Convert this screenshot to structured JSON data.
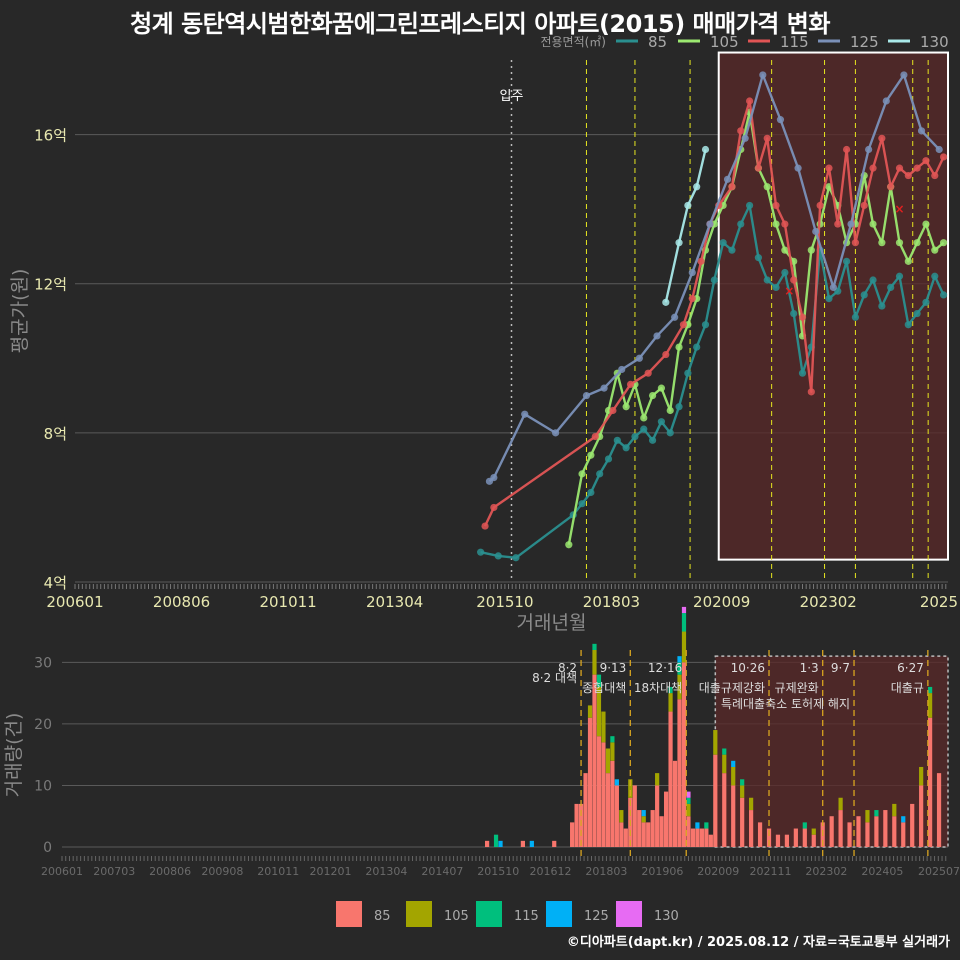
{
  "title": "청계 동탄역시범한화꿈에그린프레스티지 아파트(2015) 매매가격 변화",
  "footer": "©디아파트(dapt.kr) / 2025.08.12 / 자료=국토교통부 실거래가",
  "colors": {
    "background": "#282828",
    "grid": "#5a5a5a",
    "tick_text": "#e8e8b0",
    "axis_title": "#8a8a8a",
    "policy_line": "#e6e620",
    "policy_line_bottom": "#d9a520",
    "highlight_fill": "#5a2828",
    "highlight_stroke": "#ffffff"
  },
  "chart_data": [
    {
      "type": "line",
      "panel": "price",
      "legend_title": "전용면적(㎡)",
      "xlabel": "거래년월",
      "ylabel": "평균가(원)",
      "ylim": [
        4,
        18
      ],
      "xlim": [
        2006.0,
        2025.8
      ],
      "x_ticks": [
        "200601",
        "200806",
        "201011",
        "201304",
        "201510",
        "201803",
        "202009",
        "202302",
        "2025"
      ],
      "y_ticks": [
        "4억",
        "8억",
        "12억",
        "16억"
      ],
      "y_tick_values": [
        4,
        8,
        12,
        16
      ],
      "move_in_label": "입주",
      "move_in_x": 2015.9,
      "policy_x": [
        2017.6,
        2018.7,
        2019.95,
        2021.8,
        2023.0,
        2023.7,
        2025.0,
        2025.35
      ],
      "highlight_range": {
        "x": [
          2020.6,
          2025.8
        ],
        "y": [
          4.6,
          18.2
        ]
      },
      "outliers": [
        {
          "x": 2022.2,
          "y": 11.8
        },
        {
          "x": 2024.7,
          "y": 14.0
        }
      ],
      "series": [
        {
          "name": "85",
          "color": "#2a8f8f",
          "x": [
            2015.2,
            2015.6,
            2016.0,
            2017.3,
            2017.5,
            2017.7,
            2017.9,
            2018.1,
            2018.3,
            2018.5,
            2018.7,
            2018.9,
            2019.1,
            2019.3,
            2019.5,
            2019.7,
            2019.9,
            2020.1,
            2020.3,
            2020.5,
            2020.7,
            2020.9,
            2021.1,
            2021.3,
            2021.5,
            2021.7,
            2021.9,
            2022.1,
            2022.3,
            2022.5,
            2022.7,
            2022.9,
            2023.1,
            2023.3,
            2023.5,
            2023.7,
            2023.9,
            2024.1,
            2024.3,
            2024.5,
            2024.7,
            2024.9,
            2025.1,
            2025.3,
            2025.5,
            2025.7
          ],
          "y": [
            4.8,
            4.7,
            4.65,
            5.8,
            6.1,
            6.4,
            6.9,
            7.3,
            7.8,
            7.6,
            7.9,
            8.1,
            7.8,
            8.3,
            8.0,
            8.7,
            9.6,
            10.3,
            10.9,
            12.1,
            13.1,
            12.9,
            13.6,
            14.1,
            12.7,
            12.1,
            11.9,
            12.3,
            11.2,
            9.6,
            10.3,
            12.9,
            11.6,
            11.8,
            12.6,
            11.1,
            11.7,
            12.1,
            11.4,
            11.9,
            12.2,
            10.9,
            11.2,
            11.5,
            12.2,
            11.7
          ]
        },
        {
          "name": "105",
          "color": "#9be870",
          "x": [
            2017.2,
            2017.5,
            2017.7,
            2017.9,
            2018.1,
            2018.3,
            2018.5,
            2018.7,
            2018.9,
            2019.1,
            2019.3,
            2019.5,
            2019.7,
            2019.9,
            2020.1,
            2020.3,
            2020.5,
            2020.7,
            2020.9,
            2021.1,
            2021.3,
            2021.5,
            2021.7,
            2021.9,
            2022.1,
            2022.3,
            2022.5,
            2022.7,
            2022.9,
            2023.1,
            2023.3,
            2023.5,
            2023.7,
            2023.9,
            2024.1,
            2024.3,
            2024.5,
            2024.7,
            2024.9,
            2025.1,
            2025.3,
            2025.5,
            2025.7
          ],
          "y": [
            5.0,
            6.9,
            7.4,
            7.9,
            8.6,
            9.6,
            8.7,
            9.3,
            8.4,
            9.0,
            9.2,
            8.6,
            10.3,
            10.9,
            11.6,
            12.9,
            13.6,
            14.1,
            14.6,
            15.6,
            16.6,
            15.1,
            14.6,
            13.6,
            12.9,
            12.6,
            10.6,
            12.9,
            13.6,
            14.6,
            14.1,
            13.1,
            13.6,
            14.9,
            13.6,
            13.1,
            14.6,
            13.1,
            12.6,
            13.1,
            13.6,
            12.9,
            13.1
          ]
        },
        {
          "name": "115",
          "color": "#e05555",
          "x": [
            2015.3,
            2015.5,
            2017.8,
            2018.2,
            2018.6,
            2019.0,
            2019.4,
            2019.8,
            2020.0,
            2020.2,
            2020.4,
            2020.6,
            2020.9,
            2021.1,
            2021.3,
            2021.5,
            2021.7,
            2021.9,
            2022.1,
            2022.3,
            2022.5,
            2022.7,
            2022.9,
            2023.1,
            2023.3,
            2023.5,
            2023.7,
            2023.9,
            2024.1,
            2024.3,
            2024.5,
            2024.7,
            2024.9,
            2025.1,
            2025.3,
            2025.5,
            2025.7
          ],
          "y": [
            5.5,
            6.0,
            7.9,
            8.6,
            9.3,
            9.6,
            10.1,
            10.9,
            11.6,
            12.6,
            13.6,
            14.1,
            14.6,
            16.1,
            16.9,
            15.1,
            15.9,
            14.1,
            13.6,
            12.1,
            11.1,
            9.1,
            14.1,
            15.1,
            13.6,
            15.6,
            13.1,
            14.1,
            15.1,
            15.9,
            14.6,
            15.1,
            14.9,
            15.1,
            15.3,
            14.9,
            15.4
          ]
        },
        {
          "name": "125",
          "color": "#7a90b8",
          "x": [
            2015.4,
            2015.5,
            2016.2,
            2016.9,
            2017.6,
            2018.0,
            2018.4,
            2018.8,
            2019.2,
            2019.6,
            2020.0,
            2020.4,
            2020.8,
            2021.2,
            2021.6,
            2022.0,
            2022.4,
            2022.8,
            2023.2,
            2023.6,
            2024.0,
            2024.4,
            2024.8,
            2025.2,
            2025.6
          ],
          "y": [
            6.7,
            6.8,
            8.5,
            8.0,
            9.0,
            9.2,
            9.7,
            10.0,
            10.6,
            11.1,
            12.3,
            13.6,
            14.8,
            15.9,
            17.6,
            16.4,
            15.1,
            13.4,
            11.9,
            13.6,
            15.6,
            16.9,
            17.6,
            16.1,
            15.6
          ]
        },
        {
          "name": "130",
          "color": "#a8e8e8",
          "x": [
            2019.4,
            2019.7,
            2019.9,
            2020.1,
            2020.3
          ],
          "y": [
            11.5,
            13.1,
            14.1,
            14.6,
            15.6
          ]
        }
      ]
    },
    {
      "type": "bar",
      "panel": "volume",
      "ylabel": "거래량(건)",
      "ylim": [
        0,
        32
      ],
      "y_ticks": [
        "0",
        "10",
        "20",
        "30"
      ],
      "y_tick_values": [
        0,
        10,
        20,
        30
      ],
      "x_ticks": [
        "200601",
        "200703",
        "200806",
        "200908",
        "201011",
        "201201",
        "201304",
        "201407",
        "201510",
        "201612",
        "201803",
        "201906",
        "202009",
        "202111",
        "202302",
        "202405",
        "202507"
      ],
      "highlight_range": {
        "x": [
          2020.6,
          2025.8
        ],
        "y": [
          0,
          31
        ]
      },
      "events": [
        {
          "x": 2017.6,
          "date": "8·2",
          "label": "8·2 대책"
        },
        {
          "x": 2018.7,
          "date": "9·13",
          "label": "종합대책"
        },
        {
          "x": 2019.95,
          "date": "12·16",
          "label": "18차대책"
        },
        {
          "x": 2021.8,
          "date": "10·26",
          "label": "대출규제강화"
        },
        {
          "x": 2023.0,
          "date": "1·3",
          "label": "규제완화"
        },
        {
          "x": 2023.7,
          "date": "9·7",
          "label": "특례대출축소 토허제 해지"
        },
        {
          "x": 2025.35,
          "date": "6·27",
          "label": "대출규"
        }
      ],
      "legend": [
        {
          "name": "85",
          "color": "#f8766d"
        },
        {
          "name": "105",
          "color": "#a3a500"
        },
        {
          "name": "115",
          "color": "#00bf7d"
        },
        {
          "name": "125",
          "color": "#00b0f6"
        },
        {
          "name": "130",
          "color": "#e76bf3"
        }
      ],
      "series": [
        {
          "name": "85",
          "x": [
            2015.5,
            2016.3,
            2017.0,
            2017.4,
            2017.5,
            2017.6,
            2017.7,
            2017.8,
            2017.9,
            2018.0,
            2018.1,
            2018.2,
            2018.3,
            2018.4,
            2018.5,
            2018.6,
            2018.7,
            2018.8,
            2018.9,
            2019.0,
            2019.1,
            2019.2,
            2019.3,
            2019.4,
            2019.5,
            2019.6,
            2019.7,
            2019.8,
            2019.9,
            2020.0,
            2020.1,
            2020.2,
            2020.3,
            2020.4,
            2020.5,
            2020.6,
            2020.8,
            2021.0,
            2021.2,
            2021.4,
            2021.6,
            2021.8,
            2022.0,
            2022.2,
            2022.4,
            2022.6,
            2022.8,
            2023.0,
            2023.2,
            2023.4,
            2023.6,
            2023.8,
            2024.0,
            2024.2,
            2024.4,
            2024.6,
            2024.8,
            2025.0,
            2025.2,
            2025.4,
            2025.6
          ],
          "values": [
            1,
            1,
            1,
            4,
            7,
            7,
            12,
            21,
            28,
            18,
            17,
            12,
            14,
            10,
            4,
            3,
            8,
            10,
            6,
            4,
            4,
            6,
            10,
            5,
            9,
            22,
            14,
            24,
            30,
            5,
            3,
            3,
            3,
            3,
            2,
            15,
            12,
            10,
            8,
            6,
            4,
            3,
            2,
            2,
            3,
            3,
            2,
            4,
            5,
            6,
            4,
            5,
            4,
            5,
            6,
            5,
            4,
            7,
            10,
            21,
            12
          ]
        },
        {
          "name": "105",
          "x": [
            2017.8,
            2017.9,
            2018.0,
            2018.1,
            2018.2,
            2018.3,
            2018.5,
            2018.7,
            2019.0,
            2019.3,
            2019.6,
            2019.8,
            2019.9,
            2020.0,
            2020.6,
            2020.8,
            2021.0,
            2021.2,
            2021.4,
            2022.8,
            2023.4,
            2024.0,
            2024.6,
            2025.2,
            2025.4
          ],
          "values": [
            2,
            4,
            8,
            5,
            4,
            3,
            2,
            3,
            1,
            2,
            3,
            4,
            5,
            2,
            4,
            3,
            3,
            2,
            2,
            1,
            2,
            2,
            2,
            3,
            4
          ]
        },
        {
          "name": "115",
          "x": [
            2015.7,
            2017.9,
            2018.0,
            2018.3,
            2019.6,
            2019.8,
            2019.9,
            2020.0,
            2020.4,
            2020.8,
            2021.2,
            2022.6,
            2024.2,
            2025.4
          ],
          "values": [
            2,
            1,
            2,
            1,
            1,
            2,
            3,
            1,
            1,
            1,
            1,
            1,
            1,
            1
          ]
        },
        {
          "name": "125",
          "x": [
            2015.8,
            2016.5,
            2018.4,
            2019.0,
            2019.8,
            2020.2,
            2021.0,
            2024.8
          ],
          "values": [
            1,
            1,
            1,
            1,
            1,
            1,
            1,
            1
          ]
        },
        {
          "name": "130",
          "x": [
            2019.9,
            2020.0
          ],
          "values": [
            1,
            1
          ]
        }
      ]
    }
  ]
}
